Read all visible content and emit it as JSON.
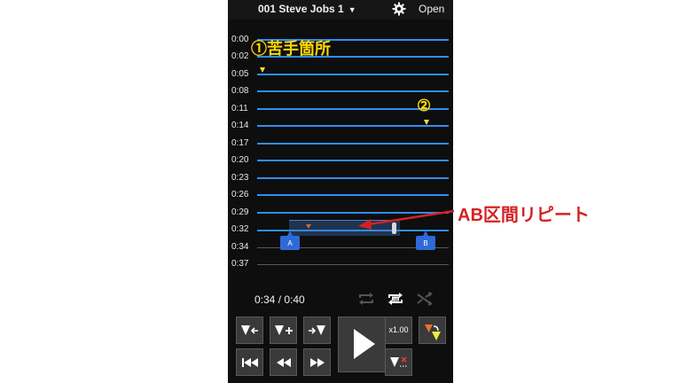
{
  "header": {
    "title": "001 Steve Jobs 1",
    "caret": "▼",
    "settings_icon": "gear-icon",
    "open_label": "Open"
  },
  "timeline": {
    "labels": [
      "0:00",
      "0:02",
      "0:05",
      "0:08",
      "0:11",
      "0:14",
      "0:17",
      "0:20",
      "0:23",
      "0:26",
      "0:29",
      "0:32",
      "0:34",
      "0:37"
    ],
    "ab_handle_a": "A",
    "ab_handle_b": "B"
  },
  "playback": {
    "time": "0:34 / 0:40",
    "speed": "x1.00"
  },
  "annotations": {
    "weak_point": "①苦手箇所",
    "marker_2": "②",
    "ab_repeat": "AB区間リピート"
  },
  "colors": {
    "waveline": "#2f8ff5",
    "marker": "#ffe033",
    "handle": "#2f69d8",
    "annotation_red": "#d42222",
    "annotation_gold": "#ffd700"
  }
}
